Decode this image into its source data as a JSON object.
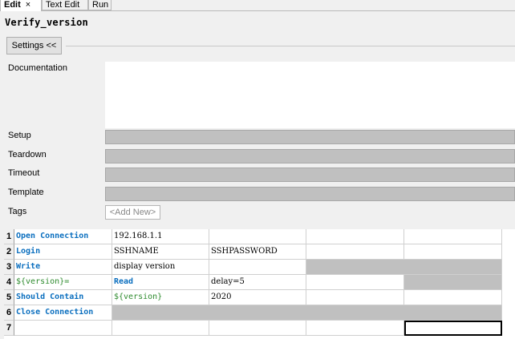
{
  "tabs": [
    {
      "label": "Edit",
      "active": true,
      "close": "×"
    },
    {
      "label": "Text Edit",
      "active": false
    },
    {
      "label": "Run",
      "active": false
    }
  ],
  "title": "Verify_version",
  "settings_button": "Settings <<",
  "fields": {
    "documentation": "Documentation",
    "setup": "Setup",
    "teardown": "Teardown",
    "timeout": "Timeout",
    "template": "Template",
    "tags": "Tags"
  },
  "add_new": "<Add New>",
  "colors": {
    "keyword": "#0b6fbf",
    "variable": "#2e8b2e",
    "disabled_cell": "#c0c0c0"
  },
  "rows": [
    {
      "num": "1",
      "c1": "Open Connection",
      "c2": "192.168.1.1",
      "c3": "",
      "c4": "",
      "c5": ""
    },
    {
      "num": "2",
      "c1": "Login",
      "c2": "SSHNAME",
      "c3": "SSHPASSWORD",
      "c4": "",
      "c5": ""
    },
    {
      "num": "3",
      "c1": "Write",
      "c2": "display version",
      "c3": "",
      "c4": "",
      "c5": ""
    },
    {
      "num": "4",
      "c1": "${version}=",
      "c2": "Read",
      "c3": "delay=5",
      "c4": "",
      "c5": ""
    },
    {
      "num": "5",
      "c1": "Should Contain",
      "c2": "${version}",
      "c3": "2020",
      "c4": "",
      "c5": ""
    },
    {
      "num": "6",
      "c1": "Close Connection",
      "c2": "",
      "c3": "",
      "c4": "",
      "c5": ""
    },
    {
      "num": "7",
      "c1": "",
      "c2": "",
      "c3": "",
      "c4": "",
      "c5": ""
    }
  ]
}
